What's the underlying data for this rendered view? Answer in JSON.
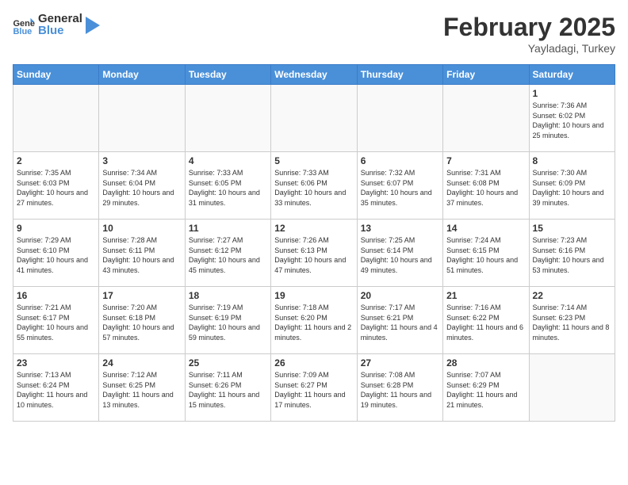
{
  "header": {
    "logo_general": "General",
    "logo_blue": "Blue",
    "month_title": "February 2025",
    "location": "Yayladagi, Turkey"
  },
  "weekdays": [
    "Sunday",
    "Monday",
    "Tuesday",
    "Wednesday",
    "Thursday",
    "Friday",
    "Saturday"
  ],
  "weeks": [
    [
      {
        "day": "",
        "info": ""
      },
      {
        "day": "",
        "info": ""
      },
      {
        "day": "",
        "info": ""
      },
      {
        "day": "",
        "info": ""
      },
      {
        "day": "",
        "info": ""
      },
      {
        "day": "",
        "info": ""
      },
      {
        "day": "1",
        "info": "Sunrise: 7:36 AM\nSunset: 6:02 PM\nDaylight: 10 hours and 25 minutes."
      }
    ],
    [
      {
        "day": "2",
        "info": "Sunrise: 7:35 AM\nSunset: 6:03 PM\nDaylight: 10 hours and 27 minutes."
      },
      {
        "day": "3",
        "info": "Sunrise: 7:34 AM\nSunset: 6:04 PM\nDaylight: 10 hours and 29 minutes."
      },
      {
        "day": "4",
        "info": "Sunrise: 7:33 AM\nSunset: 6:05 PM\nDaylight: 10 hours and 31 minutes."
      },
      {
        "day": "5",
        "info": "Sunrise: 7:33 AM\nSunset: 6:06 PM\nDaylight: 10 hours and 33 minutes."
      },
      {
        "day": "6",
        "info": "Sunrise: 7:32 AM\nSunset: 6:07 PM\nDaylight: 10 hours and 35 minutes."
      },
      {
        "day": "7",
        "info": "Sunrise: 7:31 AM\nSunset: 6:08 PM\nDaylight: 10 hours and 37 minutes."
      },
      {
        "day": "8",
        "info": "Sunrise: 7:30 AM\nSunset: 6:09 PM\nDaylight: 10 hours and 39 minutes."
      }
    ],
    [
      {
        "day": "9",
        "info": "Sunrise: 7:29 AM\nSunset: 6:10 PM\nDaylight: 10 hours and 41 minutes."
      },
      {
        "day": "10",
        "info": "Sunrise: 7:28 AM\nSunset: 6:11 PM\nDaylight: 10 hours and 43 minutes."
      },
      {
        "day": "11",
        "info": "Sunrise: 7:27 AM\nSunset: 6:12 PM\nDaylight: 10 hours and 45 minutes."
      },
      {
        "day": "12",
        "info": "Sunrise: 7:26 AM\nSunset: 6:13 PM\nDaylight: 10 hours and 47 minutes."
      },
      {
        "day": "13",
        "info": "Sunrise: 7:25 AM\nSunset: 6:14 PM\nDaylight: 10 hours and 49 minutes."
      },
      {
        "day": "14",
        "info": "Sunrise: 7:24 AM\nSunset: 6:15 PM\nDaylight: 10 hours and 51 minutes."
      },
      {
        "day": "15",
        "info": "Sunrise: 7:23 AM\nSunset: 6:16 PM\nDaylight: 10 hours and 53 minutes."
      }
    ],
    [
      {
        "day": "16",
        "info": "Sunrise: 7:21 AM\nSunset: 6:17 PM\nDaylight: 10 hours and 55 minutes."
      },
      {
        "day": "17",
        "info": "Sunrise: 7:20 AM\nSunset: 6:18 PM\nDaylight: 10 hours and 57 minutes."
      },
      {
        "day": "18",
        "info": "Sunrise: 7:19 AM\nSunset: 6:19 PM\nDaylight: 10 hours and 59 minutes."
      },
      {
        "day": "19",
        "info": "Sunrise: 7:18 AM\nSunset: 6:20 PM\nDaylight: 11 hours and 2 minutes."
      },
      {
        "day": "20",
        "info": "Sunrise: 7:17 AM\nSunset: 6:21 PM\nDaylight: 11 hours and 4 minutes."
      },
      {
        "day": "21",
        "info": "Sunrise: 7:16 AM\nSunset: 6:22 PM\nDaylight: 11 hours and 6 minutes."
      },
      {
        "day": "22",
        "info": "Sunrise: 7:14 AM\nSunset: 6:23 PM\nDaylight: 11 hours and 8 minutes."
      }
    ],
    [
      {
        "day": "23",
        "info": "Sunrise: 7:13 AM\nSunset: 6:24 PM\nDaylight: 11 hours and 10 minutes."
      },
      {
        "day": "24",
        "info": "Sunrise: 7:12 AM\nSunset: 6:25 PM\nDaylight: 11 hours and 13 minutes."
      },
      {
        "day": "25",
        "info": "Sunrise: 7:11 AM\nSunset: 6:26 PM\nDaylight: 11 hours and 15 minutes."
      },
      {
        "day": "26",
        "info": "Sunrise: 7:09 AM\nSunset: 6:27 PM\nDaylight: 11 hours and 17 minutes."
      },
      {
        "day": "27",
        "info": "Sunrise: 7:08 AM\nSunset: 6:28 PM\nDaylight: 11 hours and 19 minutes."
      },
      {
        "day": "28",
        "info": "Sunrise: 7:07 AM\nSunset: 6:29 PM\nDaylight: 11 hours and 21 minutes."
      },
      {
        "day": "",
        "info": ""
      }
    ]
  ]
}
